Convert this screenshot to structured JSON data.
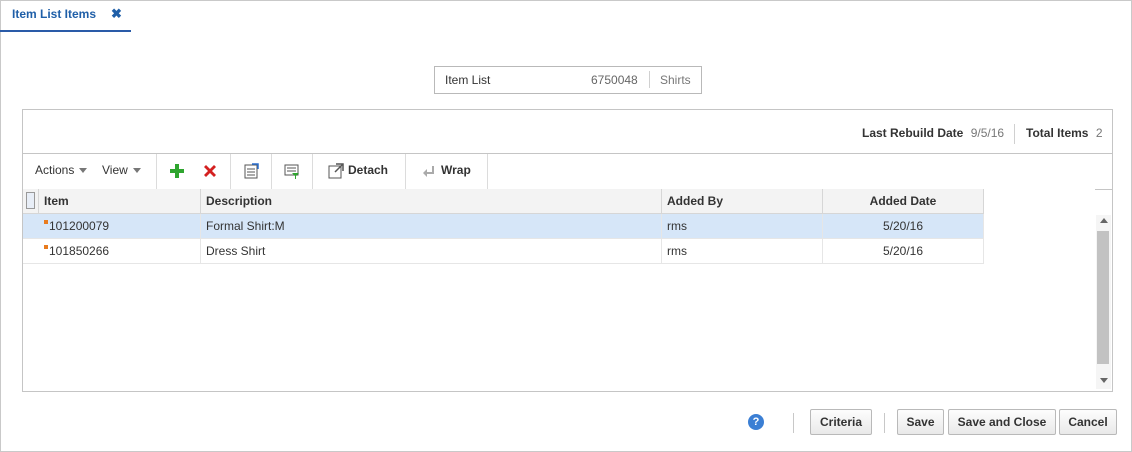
{
  "tab": {
    "label": "Item List Items",
    "close": "✖"
  },
  "item_list": {
    "label": "Item List",
    "id": "6750048",
    "name": "Shirts"
  },
  "summary": {
    "last_rebuild_label": "Last Rebuild Date",
    "last_rebuild_value": "9/5/16",
    "total_items_label": "Total Items",
    "total_items_value": "2"
  },
  "toolbar": {
    "actions": "Actions",
    "view": "View",
    "detach": "Detach",
    "wrap": "Wrap"
  },
  "table": {
    "columns": [
      "Item",
      "Description",
      "Added By",
      "Added Date"
    ],
    "rows": [
      {
        "item": "101200079",
        "description": "Formal Shirt:M",
        "added_by": "rms",
        "added_date": "5/20/16"
      },
      {
        "item": "101850266",
        "description": "Dress Shirt",
        "added_by": "rms",
        "added_date": "5/20/16"
      }
    ]
  },
  "footer": {
    "help": "?",
    "criteria": "Criteria",
    "save": "Save",
    "save_and_close": "Save and Close",
    "cancel": "Cancel"
  },
  "colors": {
    "accent": "#1f5fa8",
    "selected_row": "#d6e6f8",
    "add_icon": "#2fa52f",
    "delete_icon": "#d42020"
  }
}
